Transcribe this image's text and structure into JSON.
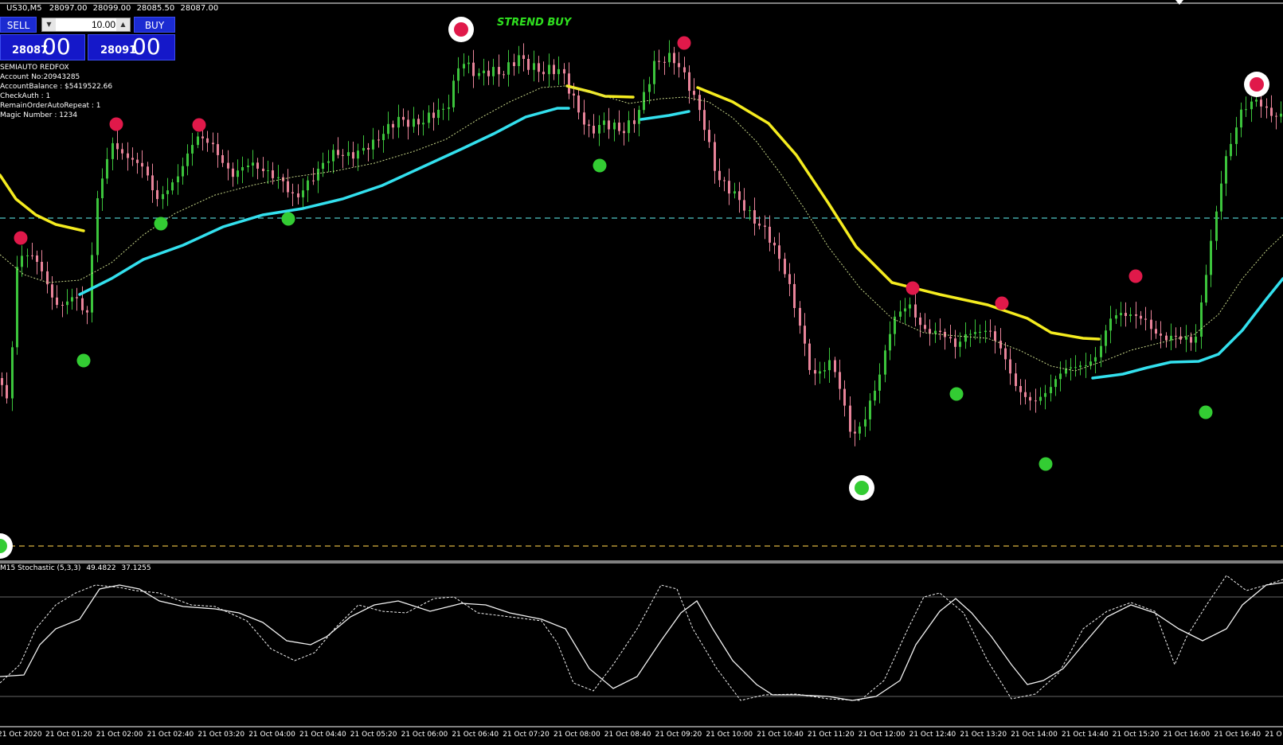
{
  "header": {
    "symbol": "US30,M5",
    "ohlc": [
      "28097.00",
      "28099.00",
      "28085.50",
      "28087.00"
    ]
  },
  "trade_panel": {
    "sell_label": "SELL",
    "buy_label": "BUY",
    "lot_value": "10.00",
    "sell_price_small": "28087",
    "sell_price_big": "00",
    "buy_price_small": "28091",
    "buy_price_big": "00"
  },
  "info": [
    "SEMIAUTO REDFOX",
    "Account No:20943285",
    "AccountBalance :  $5419522.66",
    "CheckAuth : 1",
    "RemainOrderAutoRepeat : 1",
    "Magic Number : 1234"
  ],
  "signal_text": "STREND BUY",
  "stochastic": {
    "name": "M15 Stochastic (5,3,3)",
    "main_value": "49.4822",
    "signal_value": "37.1255"
  },
  "time_axis": [
    "21 Oct 2020",
    "21 Oct 01:20",
    "21 Oct 02:00",
    "21 Oct 02:40",
    "21 Oct 03:20",
    "21 Oct 04:00",
    "21 Oct 04:40",
    "21 Oct 05:20",
    "21 Oct 06:00",
    "21 Oct 06:40",
    "21 Oct 07:20",
    "21 Oct 08:00",
    "21 Oct 08:40",
    "21 Oct 09:20",
    "21 Oct 10:00",
    "21 Oct 10:40",
    "21 Oct 11:20",
    "21 Oct 12:00",
    "21 Oct 12:40",
    "21 Oct 13:20",
    "21 Oct 14:00",
    "21 Oct 14:40",
    "21 Oct 15:20",
    "21 Oct 16:00",
    "21 Oct 16:40",
    "21 O"
  ],
  "colors": {
    "background": "#000000",
    "bull_candle": "#3cc43c",
    "bear_candle": "#e9849a",
    "ma_yellow": "#f5ec1f",
    "ma_cyan": "#33e0ee",
    "level_cyan": "#4fc6c6",
    "level_gold": "#d9b341",
    "buy_dot": "#33cc33",
    "sell_dot": "#e0194a",
    "signal_text": "#2fe01f"
  }
}
